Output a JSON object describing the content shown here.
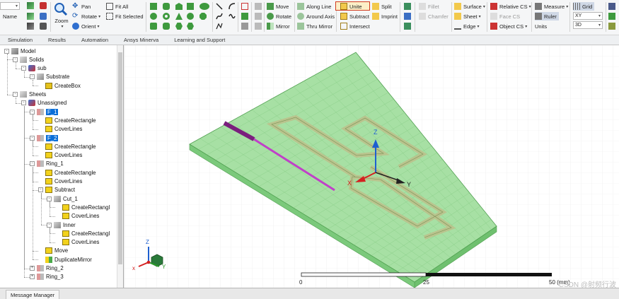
{
  "ribbon": {
    "left": {
      "name_label": "Name"
    },
    "view": {
      "pan": "Pan",
      "rotate": "Rotate",
      "orient": "Orient",
      "zoom": "Zoom",
      "fit_all": "Fit All",
      "fit_selected": "Fit Selected"
    },
    "edit": {
      "move": "Move",
      "rotate": "Rotate",
      "mirror": "Mirror"
    },
    "sweep": {
      "along_line": "Along Line",
      "around_axis": "Around Axis",
      "thru_mirror": "Thru Mirror"
    },
    "boolean": {
      "unite": "Unite",
      "subtract": "Subtract",
      "intersect": "Intersect",
      "split": "Split",
      "imprint": "Imprint"
    },
    "blend": {
      "fillet": "Fillet",
      "chamfer": "Chamfer"
    },
    "sheet": {
      "surface": "Surface",
      "sheet": "Sheet",
      "edge": "Edge"
    },
    "cs": {
      "relative_cs": "Relative CS",
      "face_cs": "Face CS",
      "object_cs": "Object CS"
    },
    "measure": {
      "measure": "Measure",
      "ruler": "Ruler",
      "units": "Units"
    },
    "grid": {
      "grid": "Grid",
      "plane": "XY",
      "mode": "3D"
    }
  },
  "tabs": [
    "Simulation",
    "Results",
    "Automation",
    "Ansys Minerva",
    "Learning and Support"
  ],
  "tree": [
    {
      "label": "Model",
      "depth": 0,
      "toggle": "-",
      "icon": "model-icon"
    },
    {
      "label": "Solids",
      "depth": 1,
      "toggle": "-",
      "icon": "folder-icon"
    },
    {
      "label": "sub",
      "depth": 2,
      "toggle": "-",
      "icon": "material-icon"
    },
    {
      "label": "Substrate",
      "depth": 3,
      "toggle": "-",
      "icon": "object-icon"
    },
    {
      "label": "CreateBox",
      "depth": 4,
      "toggle": "",
      "icon": "box-icon"
    },
    {
      "label": "Sheets",
      "depth": 1,
      "toggle": "-",
      "icon": "folder-icon"
    },
    {
      "label": "Unassigned",
      "depth": 2,
      "toggle": "-",
      "icon": "material-icon"
    },
    {
      "label": "F_1",
      "depth": 3,
      "toggle": "-",
      "icon": "sheet-icon",
      "selected": true
    },
    {
      "label": "CreateRectangle",
      "depth": 4,
      "toggle": "",
      "icon": "rect-icon"
    },
    {
      "label": "CoverLines",
      "depth": 4,
      "toggle": "",
      "icon": "rect-icon"
    },
    {
      "label": "F_2",
      "depth": 3,
      "toggle": "-",
      "icon": "sheet-icon",
      "selected": true
    },
    {
      "label": "CreateRectangle",
      "depth": 4,
      "toggle": "",
      "icon": "rect-icon"
    },
    {
      "label": "CoverLines",
      "depth": 4,
      "toggle": "",
      "icon": "rect-icon"
    },
    {
      "label": "Ring_1",
      "depth": 3,
      "toggle": "-",
      "icon": "sheet-icon"
    },
    {
      "label": "CreateRectangle",
      "depth": 4,
      "toggle": "",
      "icon": "rect-icon"
    },
    {
      "label": "CoverLines",
      "depth": 4,
      "toggle": "",
      "icon": "rect-icon"
    },
    {
      "label": "Subtract",
      "depth": 4,
      "toggle": "-",
      "icon": "subtract-icon"
    },
    {
      "label": "Cut_1",
      "depth": 5,
      "toggle": "-",
      "icon": "object-icon"
    },
    {
      "label": "CreateRectangl",
      "depth": 6,
      "toggle": "",
      "icon": "rect-icon"
    },
    {
      "label": "CoverLines",
      "depth": 6,
      "toggle": "",
      "icon": "rect-icon"
    },
    {
      "label": "Inner",
      "depth": 5,
      "toggle": "-",
      "icon": "object-icon"
    },
    {
      "label": "CreateRectangl",
      "depth": 6,
      "toggle": "",
      "icon": "rect-icon"
    },
    {
      "label": "CoverLines",
      "depth": 6,
      "toggle": "",
      "icon": "rect-icon"
    },
    {
      "label": "Move",
      "depth": 4,
      "toggle": "",
      "icon": "move-icon"
    },
    {
      "label": "DuplicateMirror",
      "depth": 4,
      "toggle": "",
      "icon": "mirror-icon"
    },
    {
      "label": "Ring_2",
      "depth": 3,
      "toggle": "+",
      "icon": "sheet-icon"
    },
    {
      "label": "Ring_3",
      "depth": 3,
      "toggle": "+",
      "icon": "sheet-icon"
    }
  ],
  "viewport": {
    "axis_x": "X",
    "axis_y": "Y",
    "axis_z": "Z",
    "triad_x": "x",
    "triad_y": "Y",
    "triad_z": "Z",
    "ruler": {
      "tick_0": "0",
      "tick_1": "25",
      "tick_2": "50 (mm)"
    }
  },
  "status": {
    "message_manager": "Message Manager"
  },
  "watermark": "CSDN @射频行波",
  "colors": {
    "substrate": "#8fd890",
    "feed": "#c040c8",
    "accent_box": "#d23a1e",
    "selection": "#0a6ed8"
  }
}
